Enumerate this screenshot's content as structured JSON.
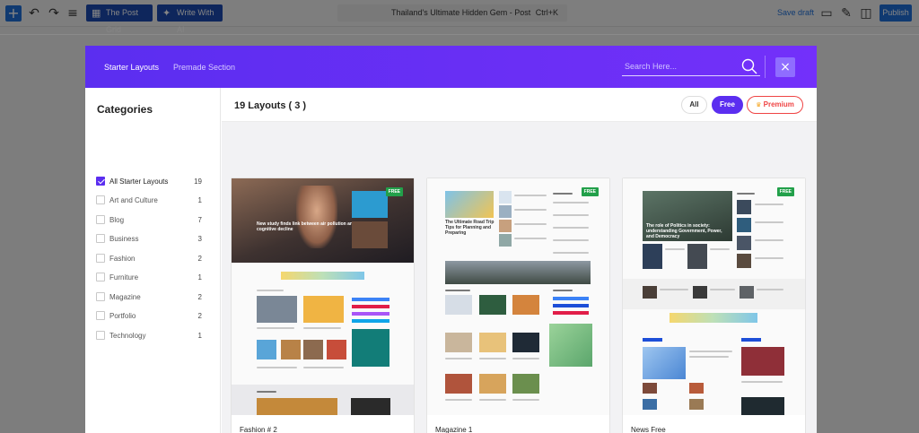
{
  "toolbar": {
    "post_grid_label": "The Post Grid",
    "write_ai_label": "Write With AI",
    "document_title": "Thailand's Ultimate Hidden Gem - Post",
    "shortcut": "Ctrl+K",
    "save_draft_label": "Save draft",
    "publish_label": "Publish"
  },
  "modal": {
    "tabs": [
      {
        "label": "Starter Layouts",
        "active": true
      },
      {
        "label": "Premade Section",
        "active": false
      }
    ],
    "search_placeholder": "Search Here...",
    "close_icon": "×"
  },
  "sidebar": {
    "title": "Categories",
    "items": [
      {
        "label": "All Starter Layouts",
        "count": "19",
        "checked": true
      },
      {
        "label": "Art and Culture",
        "count": "1",
        "checked": false
      },
      {
        "label": "Blog",
        "count": "7",
        "checked": false
      },
      {
        "label": "Business",
        "count": "3",
        "checked": false
      },
      {
        "label": "Fashion",
        "count": "2",
        "checked": false
      },
      {
        "label": "Furniture",
        "count": "1",
        "checked": false
      },
      {
        "label": "Magazine",
        "count": "2",
        "checked": false
      },
      {
        "label": "Portfolio",
        "count": "2",
        "checked": false
      },
      {
        "label": "Technology",
        "count": "1",
        "checked": false
      }
    ]
  },
  "main": {
    "heading": "19 Layouts ( 3 )",
    "filters": [
      {
        "label": "All",
        "active": false
      },
      {
        "label": "Free",
        "active": true
      },
      {
        "label": "Premium",
        "active": false
      }
    ],
    "crown_icon": "crown-icon",
    "cards": [
      {
        "name": "Fashion # 2",
        "badge": "FREE",
        "hero_text": "New study finds link between air pollution and cognitive decline"
      },
      {
        "name": "Magazine 1",
        "badge": "FREE",
        "hero_text": "The Ultimate Road Trip Tips for Planning and Preparing"
      },
      {
        "name": "News Free",
        "badge": "FREE",
        "hero_text": "The role of Politics in society: understanding Government, Power, and Democracy"
      }
    ]
  },
  "colors": {
    "accent": "#5b2ef0",
    "free_badge": "#22a04a",
    "premium": "#ef4444"
  }
}
